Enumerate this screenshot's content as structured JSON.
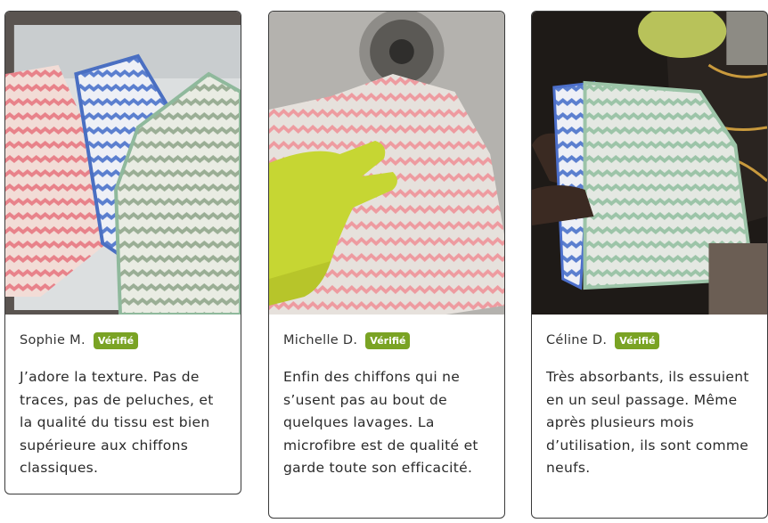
{
  "reviews": [
    {
      "author": "Sophie M.",
      "badge": "Vérifié",
      "text": "J’adore la texture. Pas de traces, pas de peluches, et la qualité du tissu est bien supérieure aux chiffons classiques."
    },
    {
      "author": "Michelle D.",
      "badge": "Vérifié",
      "text": "Enfin des chiffons qui ne s’usent pas au bout de quelques lavages. La microfibre est de qualité et garde toute son efficacité."
    },
    {
      "author": "Céline D.",
      "badge": "Vérifié",
      "text": "Très absorbants, ils essuient en un seul passage. Même après plusieurs mois d’utilisation, ils sont comme neufs."
    }
  ],
  "colors": {
    "badge": "#7aa324",
    "border": "#3a3a3a"
  }
}
